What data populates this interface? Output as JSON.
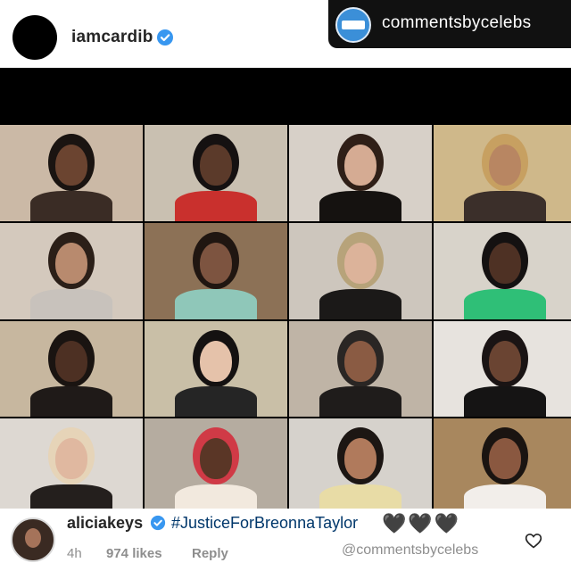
{
  "header": {
    "username": "iamcardib",
    "verified_icon": "verified-badge-icon"
  },
  "watermark": {
    "text": "commentsbycelebs",
    "logo_icon": "commentsbycelebs-logo-icon"
  },
  "video": {
    "grid_columns": 4,
    "grid_rows": 4,
    "participants": [
      {
        "bg": "#cbb9a6",
        "hair": "#1a1411",
        "skin": "#6b4430",
        "shirt": "#3a2c25"
      },
      {
        "bg": "#c9c0b1",
        "hair": "#151111",
        "skin": "#5b3a2a",
        "shirt": "#c9302d"
      },
      {
        "bg": "#d7d0c8",
        "hair": "#2f1f17",
        "skin": "#d5ab93",
        "shirt": "#151210"
      },
      {
        "bg": "#cfb88a",
        "hair": "#c7a061",
        "skin": "#b88662",
        "shirt": "#3b2f2a"
      },
      {
        "bg": "#d4c9bd",
        "hair": "#2b1f18",
        "skin": "#b88a6e",
        "shirt": "#c8c2bc"
      },
      {
        "bg": "#8c7156",
        "hair": "#201611",
        "skin": "#7d5440",
        "shirt": "#8fc7b9"
      },
      {
        "bg": "#cdc6bd",
        "hair": "#b7a37a",
        "skin": "#dcb39a",
        "shirt": "#1b1918"
      },
      {
        "bg": "#d8d3ca",
        "hair": "#141111",
        "skin": "#4e3124",
        "shirt": "#2fbf77"
      },
      {
        "bg": "#c7b79f",
        "hair": "#1a1411",
        "skin": "#4d3023",
        "shirt": "#1f1a18"
      },
      {
        "bg": "#c9bfa7",
        "hair": "#141111",
        "skin": "#e5c2aa",
        "shirt": "#252525"
      },
      {
        "bg": "#bfb4a6",
        "hair": "#2a2624",
        "skin": "#8a5b43",
        "shirt": "#1f1c1b"
      },
      {
        "bg": "#e7e3de",
        "hair": "#1a1414",
        "skin": "#6a4432",
        "shirt": "#151414"
      },
      {
        "bg": "#ddd8d2",
        "hair": "#e6d4b8",
        "skin": "#e0b8a0",
        "shirt": "#241f1d"
      },
      {
        "bg": "#b5aca0",
        "hair": "#d03a46",
        "skin": "#5a3626",
        "shirt": "#f2e9de"
      },
      {
        "bg": "#d6d2cc",
        "hair": "#1c1613",
        "skin": "#b07a5c",
        "shirt": "#e8dca6"
      },
      {
        "bg": "#a8875e",
        "hair": "#1a1411",
        "skin": "#8a5840",
        "shirt": "#f2eeea"
      }
    ]
  },
  "comment": {
    "username": "aliciakeys",
    "hashtag": "#JusticeForBreonnaTaylor",
    "hearts": "🖤🖤🖤",
    "time": "4h",
    "likes": "974 likes",
    "reply": "Reply",
    "watermark": "@commentsbycelebs",
    "like_icon": "heart-outline-icon"
  },
  "colors": {
    "verified": "#3897f0",
    "link": "#00376b",
    "muted": "#8e8e8e"
  }
}
